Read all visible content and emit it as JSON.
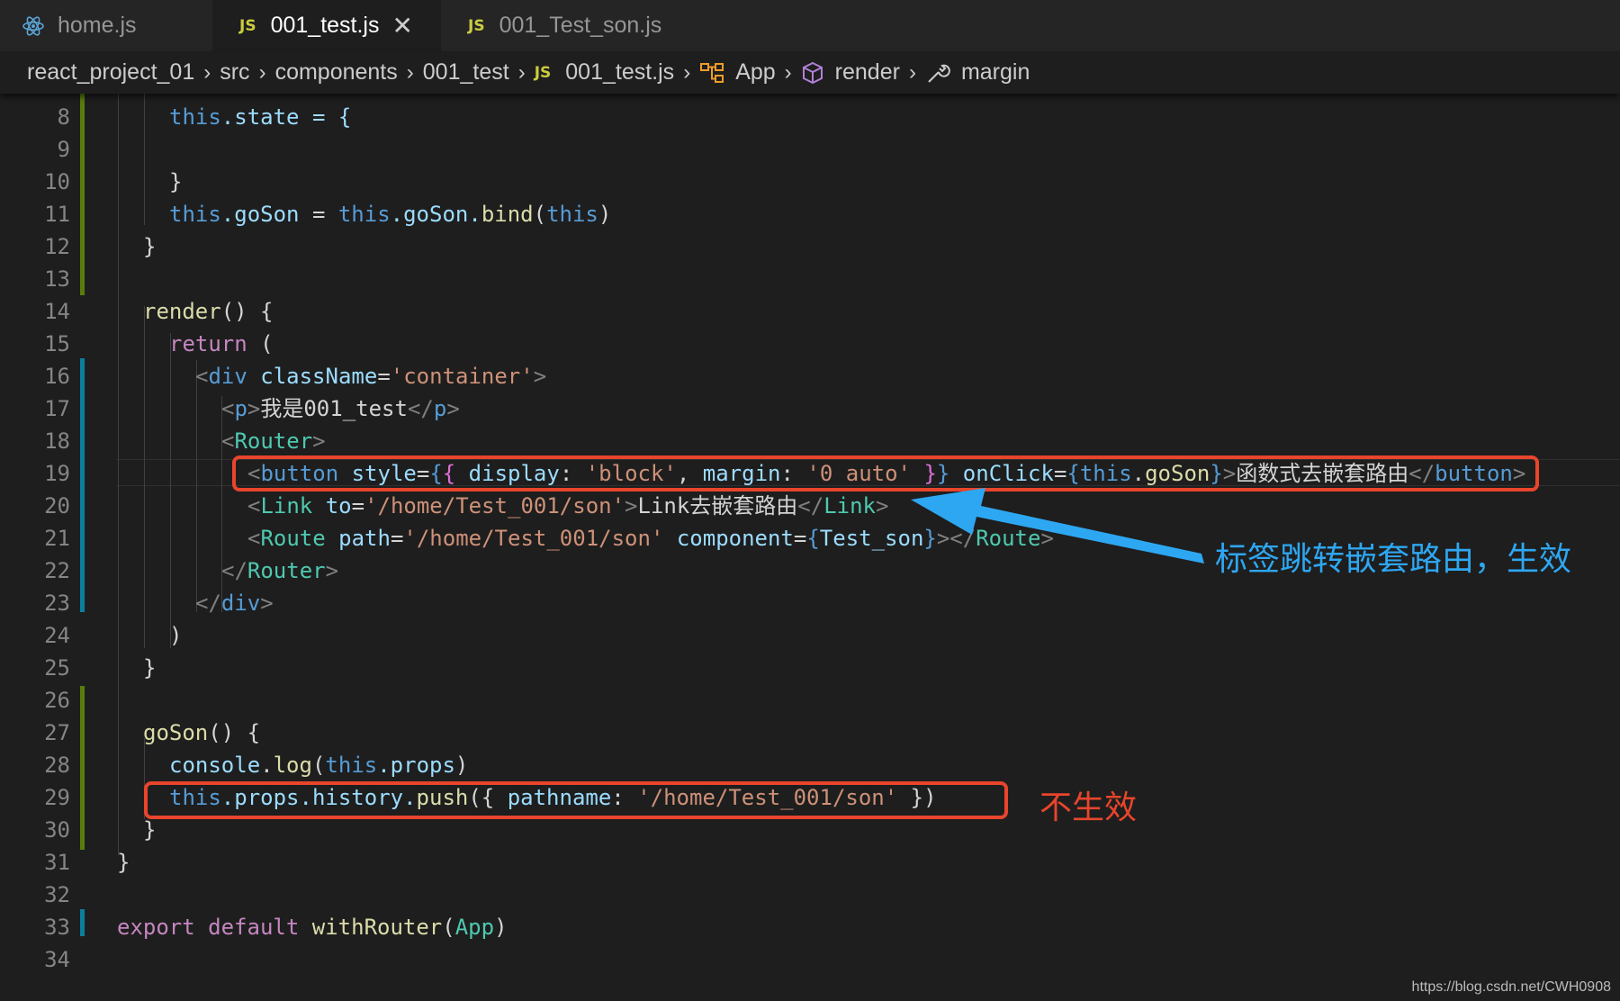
{
  "tabs": [
    {
      "label": "home.js",
      "icon": "react-icon",
      "active": false
    },
    {
      "label": "001_test.js",
      "icon": "js-icon",
      "icon_text": "JS",
      "active": true,
      "close": "✕"
    },
    {
      "label": "001_Test_son.js",
      "icon": "js-icon",
      "icon_text": "JS",
      "active": false
    }
  ],
  "breadcrumb": {
    "items": [
      "react_project_01",
      "src",
      "components",
      "001_test",
      "001_test.js",
      "App",
      "render",
      "margin"
    ],
    "js_badge": "JS",
    "separator": "›"
  },
  "editor": {
    "line_numbers": [
      "8",
      "9",
      "10",
      "11",
      "12",
      "13",
      "14",
      "15",
      "16",
      "17",
      "18",
      "19",
      "20",
      "21",
      "22",
      "23",
      "24",
      "25",
      "26",
      "27",
      "28",
      "29",
      "30",
      "31",
      "32",
      "33",
      "34"
    ]
  },
  "code_text": {
    "l8_this": "this",
    "l8_rest": ".state = {",
    "l10": "}",
    "l11_this": "this",
    "l11_prop": ".goSon",
    "l11_eq": " = ",
    "l11_this2": "this",
    "l11_prop2": ".goSon.",
    "l11_fn": "bind",
    "l11_paren": "(",
    "l11_this3": "this",
    "l11_close": ")",
    "l12": "}",
    "l14_fn": "render",
    "l14_rest": "() {",
    "l15_kw": "return",
    "l15_rest": " (",
    "l16_open": "<",
    "l16_tag": "div",
    "l16_attr": " className",
    "l16_eq": "=",
    "l16_str": "'container'",
    "l16_close": ">",
    "l17_open": "<",
    "l17_tag": "p",
    "l17_close": ">",
    "l17_text": "我是001_test",
    "l17_end": "</",
    "l17_tag2": "p",
    "l17_gt": ">",
    "l18_open": "<",
    "l18_tag": "Router",
    "l18_close": ">",
    "l19_open": "<",
    "l19_tag": "button",
    "l19_attr": " style",
    "l19_eq": "=",
    "l19_b1": "{",
    "l19_b2": "{",
    "l19_prop": " display",
    "l19_colon": ": ",
    "l19_str1": "'block'",
    "l19_comma": ", ",
    "l19_prop2": "margin",
    "l19_colon2": ": ",
    "l19_str2": "'0 auto'",
    "l19_sp": " ",
    "l19_b3": "}",
    "l19_b4": "}",
    "l19_attr2": " onClick",
    "l19_eq2": "=",
    "l19_b5": "{",
    "l19_this": "this",
    "l19_dot": ".",
    "l19_fn": "goSon",
    "l19_b6": "}",
    "l19_gt": ">",
    "l19_text": "函数式去嵌套路由",
    "l19_end": "</",
    "l19_tag2": "button",
    "l19_gt2": ">",
    "l20_open": "<",
    "l20_tag": "Link",
    "l20_attr": " to",
    "l20_eq": "=",
    "l20_str": "'/home/Test_001/son'",
    "l20_gt": ">",
    "l20_text": "Link去嵌套路由",
    "l20_end": "</",
    "l20_tag2": "Link",
    "l20_gt2": ">",
    "l21_open": "<",
    "l21_tag": "Route",
    "l21_attr": " path",
    "l21_eq": "=",
    "l21_str": "'/home/Test_001/son'",
    "l21_attr2": " component",
    "l21_eq2": "=",
    "l21_b1": "{",
    "l21_comp": "Test_son",
    "l21_b2": "}",
    "l21_end": "></",
    "l21_tag2": "Route",
    "l21_gt": ">",
    "l22_open": "</",
    "l22_tag": "Router",
    "l22_gt": ">",
    "l23_open": "</",
    "l23_tag": "div",
    "l23_gt": ">",
    "l24": ")",
    "l25": "}",
    "l27_fn": "goSon",
    "l27_rest": "() {",
    "l28_obj": "console",
    "l28_dot": ".",
    "l28_fn": "log",
    "l28_paren": "(",
    "l28_this": "this",
    "l28_prop": ".props",
    "l28_close": ")",
    "l29_this": "this",
    "l29_prop": ".props.history.",
    "l29_fn": "push",
    "l29_paren": "({ ",
    "l29_key": "pathname",
    "l29_colon": ": ",
    "l29_str": "'/home/Test_001/son'",
    "l29_close": " })",
    "l30": "}",
    "l31": "}",
    "l33_kw": "export",
    "l33_sp": " ",
    "l33_kw2": "default",
    "l33_sp2": " ",
    "l33_fn": "withRouter",
    "l33_paren": "(",
    "l33_comp": "App",
    "l33_close": ")"
  },
  "annotations": {
    "blue_label": "标签跳转嵌套路由，生效",
    "red_label": "不生效",
    "blue_color": "#2ea7f2",
    "red_color": "#e8452c"
  },
  "watermark": "https://blog.csdn.net/CWH0908"
}
